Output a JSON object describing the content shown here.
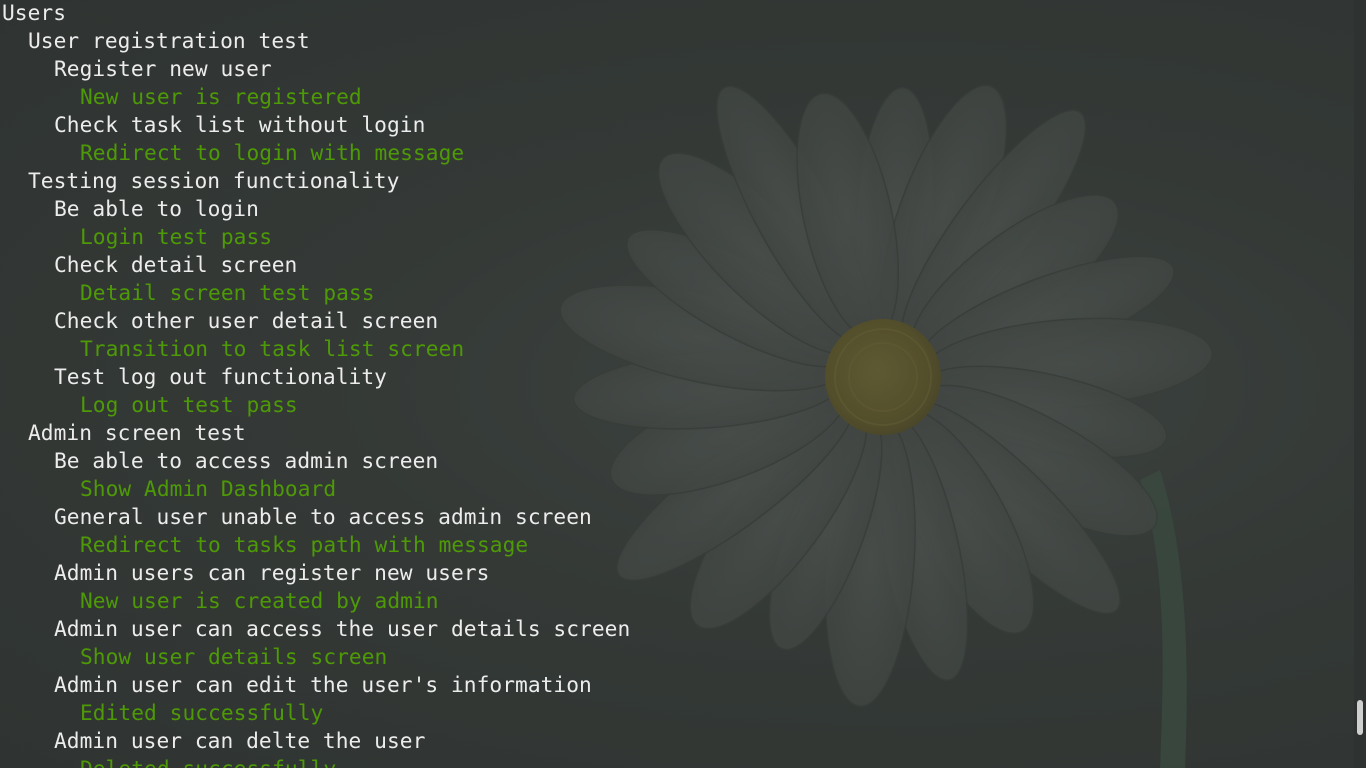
{
  "terminal": {
    "lines": [
      {
        "text": "Users",
        "indent": 0,
        "status": "suite"
      },
      {
        "text": "User registration test",
        "indent": 1,
        "status": "suite"
      },
      {
        "text": "Register new user",
        "indent": 2,
        "status": "suite"
      },
      {
        "text": "New user is registered",
        "indent": 3,
        "status": "pass"
      },
      {
        "text": "Check task list without login",
        "indent": 2,
        "status": "suite"
      },
      {
        "text": "Redirect to login with message",
        "indent": 3,
        "status": "pass"
      },
      {
        "text": "Testing session functionality",
        "indent": 1,
        "status": "suite"
      },
      {
        "text": "Be able to login",
        "indent": 2,
        "status": "suite"
      },
      {
        "text": "Login test pass",
        "indent": 3,
        "status": "pass"
      },
      {
        "text": "Check detail screen",
        "indent": 2,
        "status": "suite"
      },
      {
        "text": "Detail screen test pass",
        "indent": 3,
        "status": "pass"
      },
      {
        "text": "Check other user detail screen",
        "indent": 2,
        "status": "suite"
      },
      {
        "text": "Transition to task list screen",
        "indent": 3,
        "status": "pass"
      },
      {
        "text": "Test log out functionality",
        "indent": 2,
        "status": "suite"
      },
      {
        "text": "Log out test pass",
        "indent": 3,
        "status": "pass"
      },
      {
        "text": "Admin screen test",
        "indent": 1,
        "status": "suite"
      },
      {
        "text": "Be able to access admin screen",
        "indent": 2,
        "status": "suite"
      },
      {
        "text": "Show Admin Dashboard",
        "indent": 3,
        "status": "pass"
      },
      {
        "text": "General user unable to access admin screen",
        "indent": 2,
        "status": "suite"
      },
      {
        "text": "Redirect to tasks path with message",
        "indent": 3,
        "status": "pass"
      },
      {
        "text": "Admin users can register new users",
        "indent": 2,
        "status": "suite"
      },
      {
        "text": "New user is created by admin",
        "indent": 3,
        "status": "pass"
      },
      {
        "text": "Admin user can access the user details screen",
        "indent": 2,
        "status": "suite"
      },
      {
        "text": "Show user details screen",
        "indent": 3,
        "status": "pass"
      },
      {
        "text": "Admin user can edit the user's information",
        "indent": 2,
        "status": "suite"
      },
      {
        "text": "Edited successfully",
        "indent": 3,
        "status": "pass"
      },
      {
        "text": "Admin user can delte the user",
        "indent": 2,
        "status": "suite"
      },
      {
        "text": "Deleted successfully",
        "indent": 3,
        "status": "pass"
      }
    ]
  },
  "scrollbar": {
    "position_fraction": 0.955,
    "visible_fraction": 0.045
  },
  "colors": {
    "background": "#333836",
    "suite_text": "#ececec",
    "pass_text": "#4e9a06",
    "scroll_thumb": "#cfcfcf"
  }
}
